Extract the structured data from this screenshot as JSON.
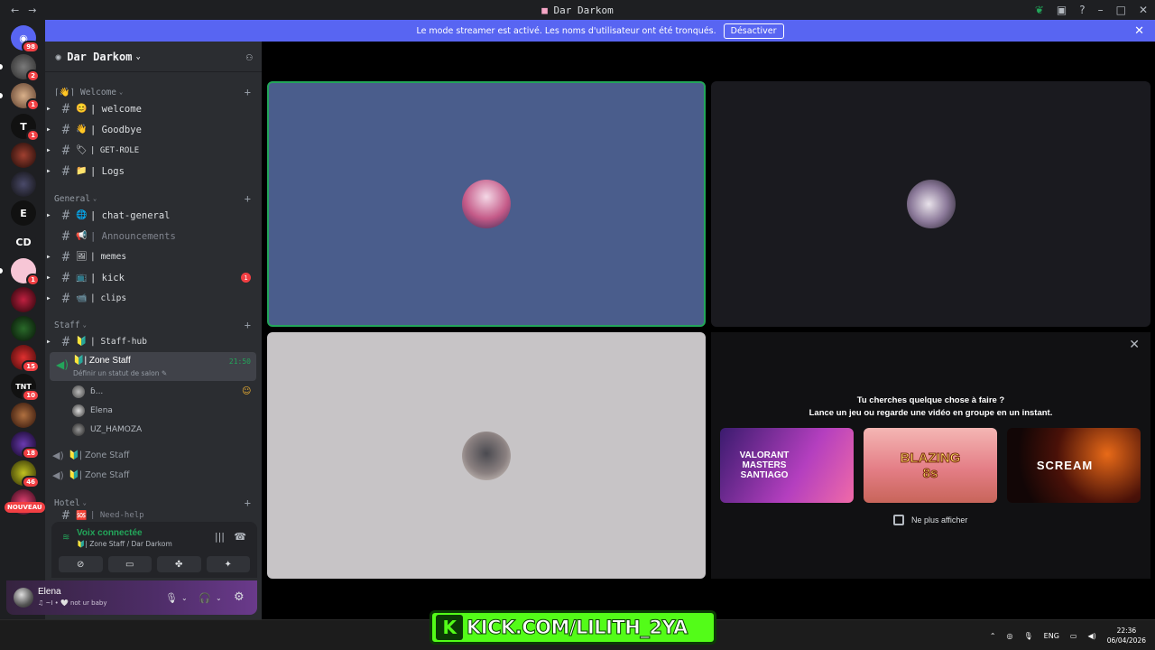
{
  "window": {
    "title": "Dar Darkom",
    "back": "←",
    "forward": "→"
  },
  "banner": {
    "text": "Le mode streamer est activé. Les noms d'utilisateur ont été tronqués.",
    "button": "Désactiver"
  },
  "rail": {
    "servers": [
      {
        "badge": "98"
      },
      {
        "badge": "2"
      },
      {
        "badge": "1"
      },
      {
        "badge": "1"
      },
      {
        "badge": ""
      },
      {
        "badge": ""
      },
      {
        "badge": ""
      },
      {
        "label": "CD"
      },
      {
        "badge": "1"
      },
      {
        "badge": ""
      },
      {
        "badge": ""
      },
      {
        "badge": "15"
      },
      {
        "badge": "10"
      },
      {
        "badge": ""
      },
      {
        "badge": "18"
      },
      {
        "badge": "46"
      }
    ],
    "new_label": "NOUVEAU"
  },
  "server": {
    "name": "Dar Darkom"
  },
  "categories": {
    "welcome": "⌈👋⌉ Welcome",
    "general": "General",
    "staff": "Staff",
    "hotel": "Hotel"
  },
  "channels": {
    "welcome": "| welcome",
    "goodbye": "| Goodbye",
    "getrole": "| GET-ROLE",
    "logs": "| Logs",
    "chat": "| chat-general",
    "announcements": "| Announcements",
    "memes": "| memes",
    "kick": "| kick",
    "clips": "| clips",
    "staffhub": "| Staff-hub",
    "needhelp": "| Need-help"
  },
  "channel_badges": {
    "kick": "1"
  },
  "voice_channel": {
    "name": "| Zone Staff",
    "status": "Définir un statut de salon",
    "time": "21:50"
  },
  "members": [
    "ɓ...",
    "Elena",
    "UZ_HAMOZA"
  ],
  "voice_channels": [
    "| Zone Staff",
    "| Zone Staff"
  ],
  "voice_panel": {
    "state": "Voix connectée",
    "location": "| Zone Staff / Dar Darkom"
  },
  "user": {
    "name": "Elena",
    "status": "♫ ~I • 🤍 not ur baby"
  },
  "activity": {
    "line1": "Tu cherches quelque chose à faire ?",
    "line2": "Lance un jeu ou regarde une vidéo en groupe en un instant.",
    "cards": [
      "VALORANT MASTERS SANTIAGO",
      "BLAZING 8s",
      "SCREAM"
    ],
    "checkbox": "Ne plus afficher"
  },
  "overlay": {
    "kick": "KICK.COM/LILITH_2YA"
  },
  "tray": {
    "lang": "ENG",
    "time": "22:36",
    "date": "06/04/2026"
  },
  "colors": {
    "accent": "#5865f2",
    "online": "#23a55a",
    "danger": "#f23f43",
    "kick": "#53fc18"
  }
}
